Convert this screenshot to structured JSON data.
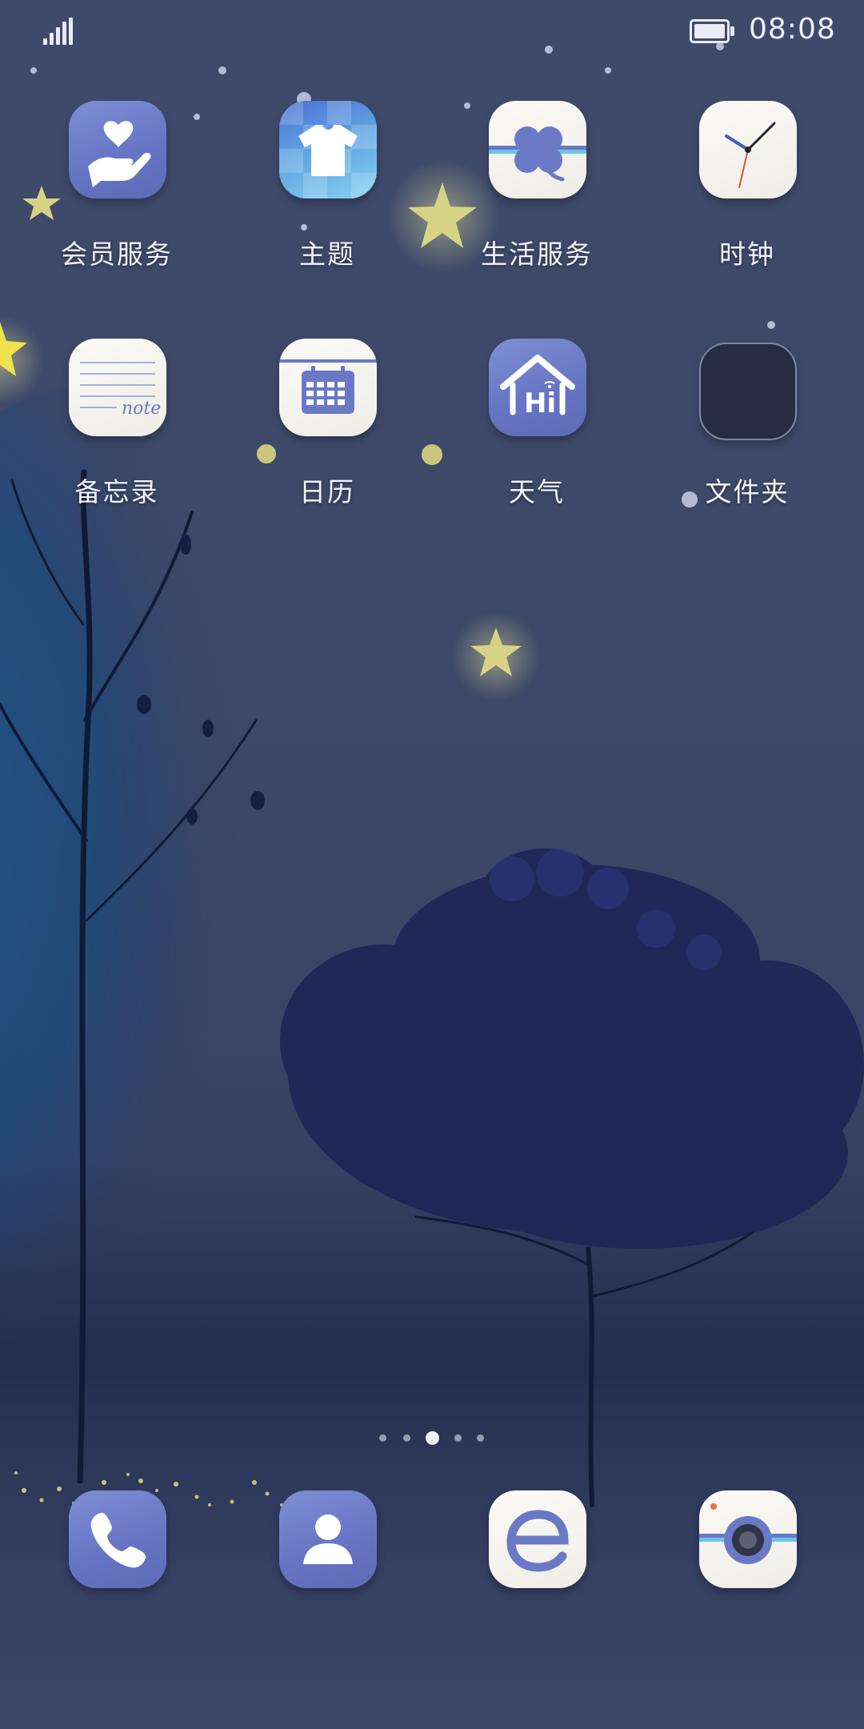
{
  "status_bar": {
    "time": "08:08",
    "signal_icon": "signal-strength-icon",
    "battery_icon": "battery-icon"
  },
  "apps": [
    {
      "label": "会员服务",
      "icon": "heart-in-hand-icon"
    },
    {
      "label": "主题",
      "icon": "tshirt-icon"
    },
    {
      "label": "生活服务",
      "icon": "clover-icon"
    },
    {
      "label": "时钟",
      "icon": "clock-icon"
    },
    {
      "label": "备忘录",
      "icon": "notepad-icon"
    },
    {
      "label": "日历",
      "icon": "calendar-icon"
    },
    {
      "label": "天气",
      "icon": "home-hi-icon"
    },
    {
      "label": "文件夹",
      "icon": "folder-icon"
    }
  ],
  "note_icon_text": "note",
  "hi_icon_text": "Hi",
  "page_indicator": {
    "count": 5,
    "active_index": 2
  },
  "dock": [
    {
      "name": "phone",
      "icon": "phone-icon"
    },
    {
      "name": "contacts",
      "icon": "contacts-icon"
    },
    {
      "name": "browser",
      "icon": "browser-e-icon"
    },
    {
      "name": "camera",
      "icon": "camera-icon"
    }
  ],
  "colors": {
    "background": "#3d4868",
    "icon_blue": "#6a79c6",
    "icon_white": "#f5f3ee",
    "star": "#d9d58a"
  }
}
